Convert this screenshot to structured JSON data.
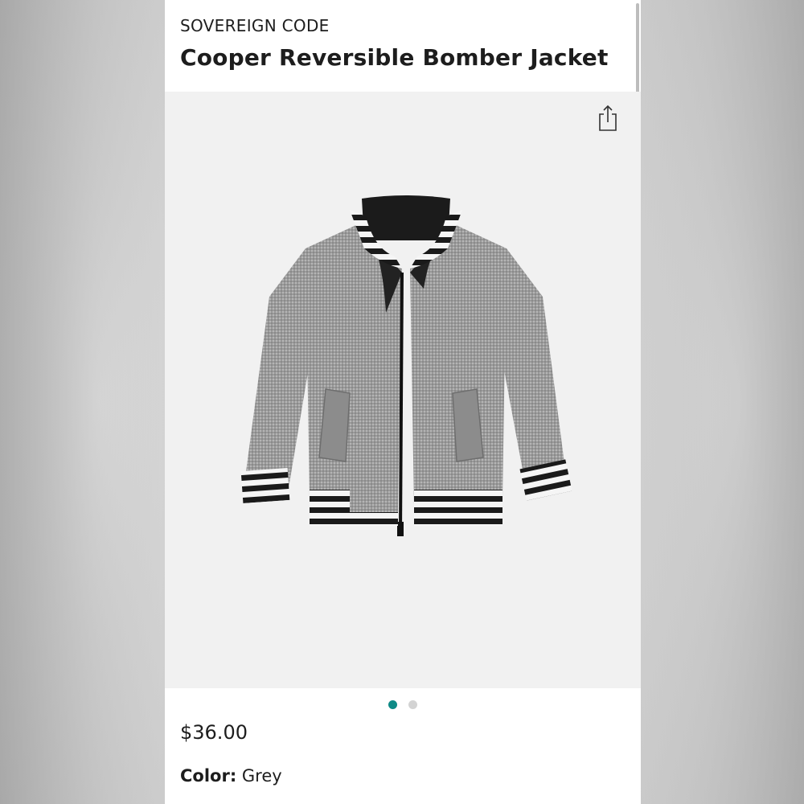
{
  "product": {
    "brand": "SOVEREIGN CODE",
    "title": "Cooper Reversible Bomber Jacket",
    "price": "$36.00",
    "color_label": "Color:",
    "color_value": "Grey"
  },
  "gallery": {
    "image_count": 2,
    "active_index": 0,
    "accent_color": "#0e8a86",
    "inactive_color": "#d3d3d3",
    "background_color": "#f1f1f1"
  },
  "icons": {
    "share": "share-icon"
  }
}
